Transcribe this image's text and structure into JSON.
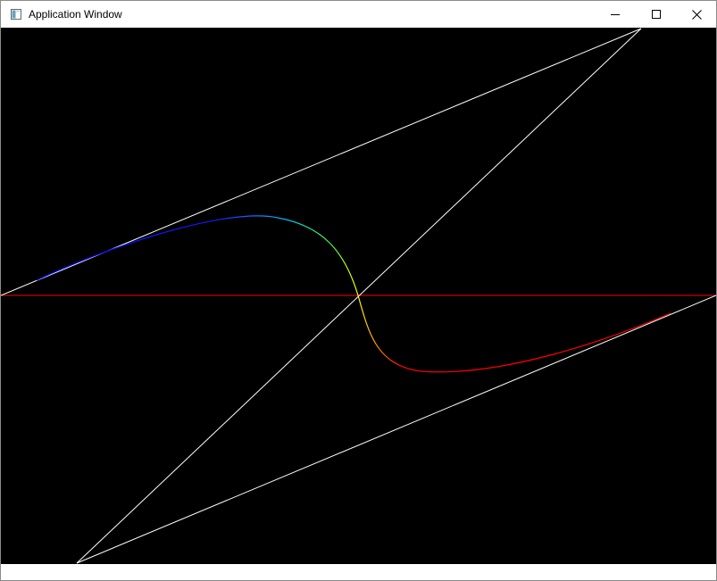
{
  "window": {
    "title": "Application Window",
    "app_icon": "window-app-icon",
    "controls": {
      "minimize_icon": "minimize-icon",
      "maximize_icon": "maximize-icon",
      "close_icon": "close-icon"
    }
  },
  "canvas": {
    "background_color": "#000000",
    "axis_color": "#ff0000",
    "construction_line_color": "#ffffff",
    "curve_gradient": [
      "#0000ff",
      "#00bfff",
      "#ffff00",
      "#ff0000"
    ]
  }
}
